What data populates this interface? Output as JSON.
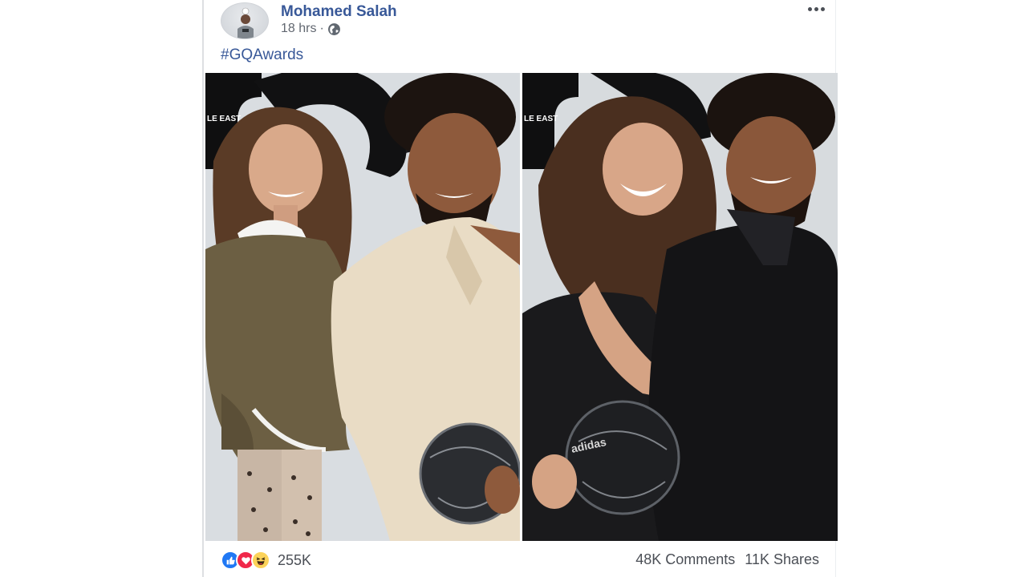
{
  "post": {
    "author": "Mohamed Salah",
    "time": "18 hrs",
    "separator": "·",
    "caption": "#GQAwards",
    "magazine_fragment": "LE EAST",
    "ball_brand": "adidas"
  },
  "engagement": {
    "reactions": [
      "like",
      "love",
      "haha"
    ],
    "reaction_count": "255K",
    "comments": "48K Comments",
    "shares": "11K Shares"
  },
  "colors": {
    "link": "#385898",
    "like": "#2078f4",
    "love": "#f0284a",
    "haha": "#fcd35a",
    "secondary_text": "#616770"
  },
  "icons": {
    "privacy": "globe-icon",
    "menu": "more-options-icon"
  }
}
